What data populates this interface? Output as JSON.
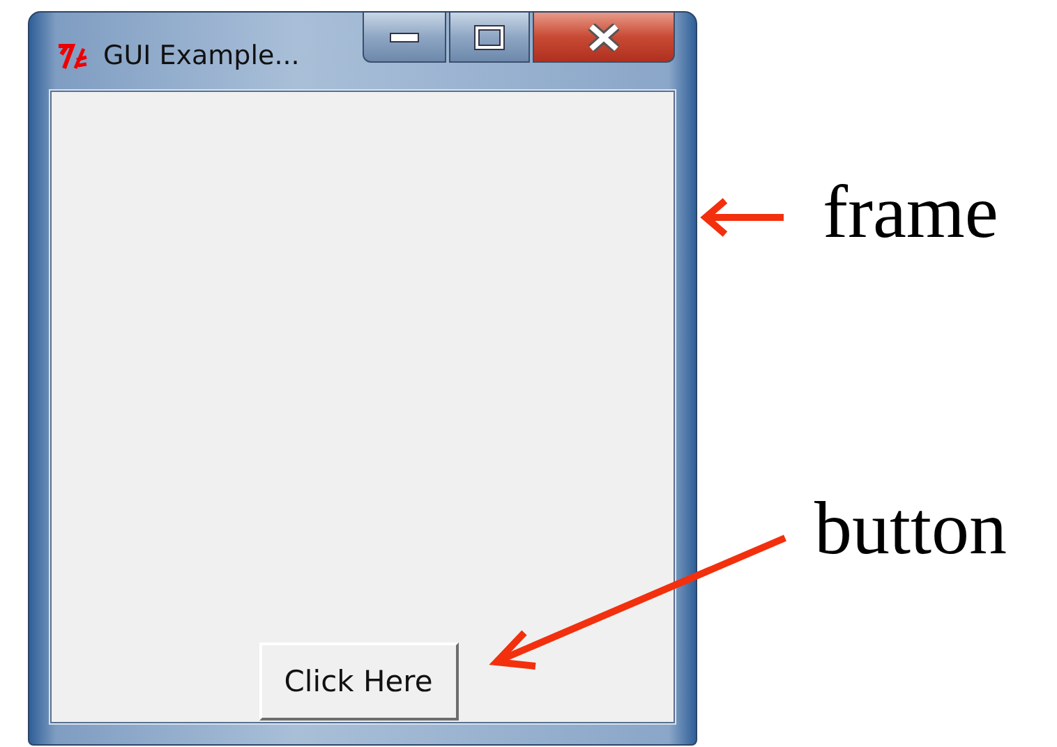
{
  "window": {
    "title": "GUI Example..."
  },
  "button": {
    "label": "Click Here"
  },
  "annotations": [
    {
      "label": "frame"
    },
    {
      "label": "button"
    }
  ]
}
